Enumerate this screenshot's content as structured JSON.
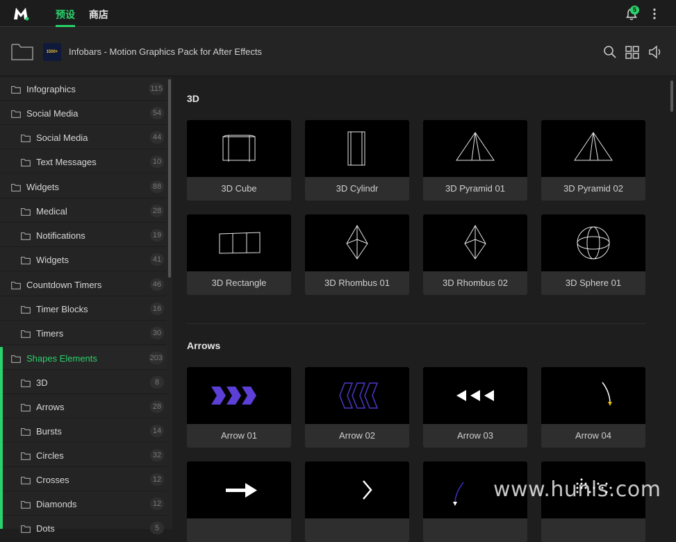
{
  "topbar": {
    "tabs": [
      {
        "label": "预设",
        "active": true
      },
      {
        "label": "商店",
        "active": false
      }
    ],
    "notification_count": "5",
    "accent_color": "#2ad16c"
  },
  "header": {
    "pack_title": "Infobars - Motion Graphics Pack for After Effects",
    "pack_thumb_text": "1500+ INFOBARS"
  },
  "sidebar": {
    "items": [
      {
        "label": "Infographics",
        "count": "115",
        "level": 0
      },
      {
        "label": "Social Media",
        "count": "54",
        "level": 0
      },
      {
        "label": "Social Media",
        "count": "44",
        "level": 1
      },
      {
        "label": "Text Messages",
        "count": "10",
        "level": 1
      },
      {
        "label": "Widgets",
        "count": "88",
        "level": 0
      },
      {
        "label": "Medical",
        "count": "28",
        "level": 1
      },
      {
        "label": "Notifications",
        "count": "19",
        "level": 1
      },
      {
        "label": "Widgets",
        "count": "41",
        "level": 1
      },
      {
        "label": "Countdown Timers",
        "count": "46",
        "level": 0
      },
      {
        "label": "Timer Blocks",
        "count": "16",
        "level": 1
      },
      {
        "label": "Timers",
        "count": "30",
        "level": 1
      },
      {
        "label": "Shapes Elements",
        "count": "203",
        "level": 0,
        "active": true
      },
      {
        "label": "3D",
        "count": "8",
        "level": 1
      },
      {
        "label": "Arrows",
        "count": "28",
        "level": 1
      },
      {
        "label": "Bursts",
        "count": "14",
        "level": 1
      },
      {
        "label": "Circles",
        "count": "32",
        "level": 1
      },
      {
        "label": "Crosses",
        "count": "12",
        "level": 1
      },
      {
        "label": "Diamonds",
        "count": "12",
        "level": 1
      },
      {
        "label": "Dots",
        "count": "5",
        "level": 1
      }
    ]
  },
  "sections": [
    {
      "title": "3D",
      "cards": [
        {
          "label": "3D Cube",
          "icon": "cube-icon"
        },
        {
          "label": "3D Cylindr",
          "icon": "cylinder-icon"
        },
        {
          "label": "3D Pyramid 01",
          "icon": "pyramid-icon"
        },
        {
          "label": "3D Pyramid 02",
          "icon": "pyramid-icon"
        },
        {
          "label": "3D Rectangle",
          "icon": "rectangle-prism-icon"
        },
        {
          "label": "3D Rhombus 01",
          "icon": "rhombus-icon"
        },
        {
          "label": "3D Rhombus 02",
          "icon": "rhombus-icon"
        },
        {
          "label": "3D Sphere 01",
          "icon": "sphere-icon"
        }
      ]
    },
    {
      "title": "Arrows",
      "cards": [
        {
          "label": "Arrow 01",
          "icon": "chevrons-right-icon"
        },
        {
          "label": "Arrow 02",
          "icon": "chevrons-left-outline-icon"
        },
        {
          "label": "Arrow 03",
          "icon": "triangles-left-icon"
        },
        {
          "label": "Arrow 04",
          "icon": "curved-arrow-icon"
        },
        {
          "label": "",
          "icon": "arrow-right-icon"
        },
        {
          "label": "",
          "icon": "chevron-right-icon"
        },
        {
          "label": "",
          "icon": "curved-arrow-down-icon"
        },
        {
          "label": "",
          "icon": "dotted-shape-icon"
        }
      ]
    }
  ],
  "watermark": "www.hunls.com"
}
